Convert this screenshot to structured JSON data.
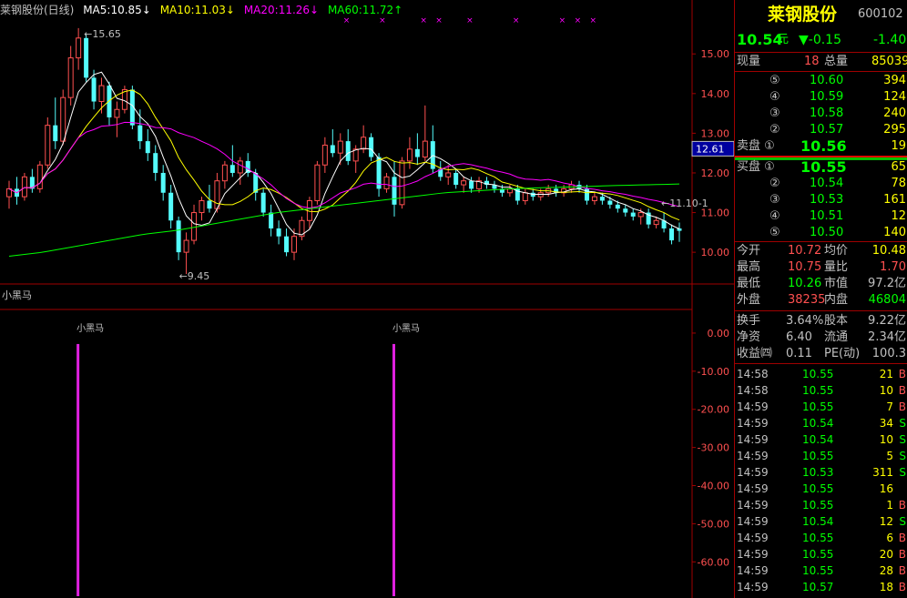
{
  "chart_header": {
    "stock_period": "莱钢股份(日线)",
    "ma5": "MA5:10.85↓",
    "ma10": "MA10:11.03↓",
    "ma20": "MA20:11.26↓",
    "ma60": "MA60:11.72↑",
    "colors": {
      "ma5": "#ffffff",
      "ma10": "#ffff00",
      "ma20": "#ff00ff",
      "ma60": "#00ff00"
    }
  },
  "annotations": {
    "high": "15.65",
    "low": "9.45",
    "last": "11.10-1",
    "price_tag": "12.61"
  },
  "subchart": {
    "title": "小黑马",
    "bar_label": "小黑马"
  },
  "chart_data": [
    {
      "type": "candlestick",
      "title": "莱钢股份(日线)",
      "y_ticks": [
        "15.00",
        "14.00",
        "13.00",
        "12.00",
        "11.00",
        "10.00"
      ],
      "ylim": [
        9.2,
        15.9
      ],
      "ohlc": [
        [
          11.4,
          11.8,
          11.1,
          11.6
        ],
        [
          11.6,
          11.9,
          11.2,
          11.4
        ],
        [
          11.4,
          12.0,
          11.3,
          11.9
        ],
        [
          11.9,
          12.1,
          11.5,
          11.6
        ],
        [
          11.6,
          12.3,
          11.5,
          12.2
        ],
        [
          12.2,
          13.4,
          12.1,
          13.2
        ],
        [
          13.2,
          13.9,
          12.6,
          12.8
        ],
        [
          12.8,
          14.1,
          12.7,
          13.9
        ],
        [
          13.9,
          15.2,
          13.7,
          14.9
        ],
        [
          14.9,
          15.65,
          14.6,
          15.4
        ],
        [
          15.4,
          15.5,
          14.3,
          14.4
        ],
        [
          14.4,
          14.6,
          13.6,
          13.8
        ],
        [
          13.8,
          14.4,
          13.5,
          14.2
        ],
        [
          14.2,
          14.3,
          13.2,
          13.4
        ],
        [
          13.4,
          13.8,
          12.9,
          13.6
        ],
        [
          13.6,
          14.2,
          13.5,
          14.1
        ],
        [
          14.1,
          14.2,
          13.1,
          13.2
        ],
        [
          13.2,
          13.6,
          12.6,
          12.8
        ],
        [
          12.8,
          13.1,
          12.3,
          12.5
        ],
        [
          12.5,
          12.7,
          11.8,
          12.0
        ],
        [
          12.0,
          12.2,
          11.3,
          11.5
        ],
        [
          11.5,
          11.7,
          10.6,
          10.8
        ],
        [
          10.8,
          10.9,
          9.8,
          10.0
        ],
        [
          10.0,
          10.5,
          9.45,
          10.3
        ],
        [
          10.3,
          11.2,
          10.2,
          11.0
        ],
        [
          11.0,
          11.4,
          10.8,
          11.3
        ],
        [
          11.3,
          11.7,
          11.0,
          11.1
        ],
        [
          11.1,
          12.0,
          11.0,
          11.8
        ],
        [
          11.8,
          12.3,
          11.6,
          12.2
        ],
        [
          12.2,
          12.7,
          11.9,
          12.0
        ],
        [
          12.0,
          12.4,
          11.7,
          12.3
        ],
        [
          12.3,
          12.5,
          11.9,
          12.0
        ],
        [
          12.0,
          12.1,
          11.3,
          11.5
        ],
        [
          11.5,
          11.6,
          10.9,
          11.0
        ],
        [
          11.0,
          11.2,
          10.4,
          10.6
        ],
        [
          10.6,
          10.8,
          10.2,
          10.4
        ],
        [
          10.4,
          10.6,
          9.9,
          10.0
        ],
        [
          10.0,
          10.6,
          9.8,
          10.4
        ],
        [
          10.4,
          10.9,
          10.3,
          10.8
        ],
        [
          10.8,
          11.4,
          10.6,
          11.3
        ],
        [
          11.3,
          12.3,
          11.2,
          12.2
        ],
        [
          12.2,
          12.9,
          12.0,
          12.7
        ],
        [
          12.7,
          13.1,
          12.4,
          12.5
        ],
        [
          12.5,
          13.0,
          12.2,
          12.8
        ],
        [
          12.8,
          13.1,
          12.2,
          12.3
        ],
        [
          12.3,
          12.7,
          12.0,
          12.6
        ],
        [
          12.6,
          13.2,
          12.5,
          12.9
        ],
        [
          12.9,
          13.0,
          12.3,
          12.4
        ],
        [
          12.4,
          12.5,
          11.4,
          11.6
        ],
        [
          11.6,
          12.0,
          11.5,
          11.9
        ],
        [
          11.9,
          12.3,
          10.9,
          11.2
        ],
        [
          11.2,
          12.4,
          11.1,
          12.3
        ],
        [
          12.3,
          12.9,
          12.1,
          12.6
        ],
        [
          12.6,
          13.0,
          12.2,
          12.4
        ],
        [
          12.4,
          13.7,
          12.3,
          12.8
        ],
        [
          12.8,
          13.2,
          12.0,
          12.1
        ],
        [
          12.1,
          12.3,
          11.8,
          11.9
        ],
        [
          11.9,
          12.2,
          11.7,
          12.0
        ],
        [
          12.0,
          12.1,
          11.6,
          11.7
        ],
        [
          11.7,
          11.9,
          11.5,
          11.8
        ],
        [
          11.8,
          11.9,
          11.5,
          11.6
        ],
        [
          11.6,
          11.9,
          11.5,
          11.8
        ],
        [
          11.8,
          11.9,
          11.6,
          11.7
        ],
        [
          11.7,
          11.8,
          11.5,
          11.6
        ],
        [
          11.6,
          11.7,
          11.4,
          11.5
        ],
        [
          11.5,
          11.7,
          11.4,
          11.6
        ],
        [
          11.6,
          11.7,
          11.2,
          11.3
        ],
        [
          11.3,
          11.6,
          11.2,
          11.5
        ],
        [
          11.5,
          11.6,
          11.3,
          11.4
        ],
        [
          11.4,
          11.6,
          11.3,
          11.5
        ],
        [
          11.5,
          11.7,
          11.4,
          11.6
        ],
        [
          11.6,
          11.7,
          11.4,
          11.5
        ],
        [
          11.5,
          11.7,
          11.4,
          11.6
        ],
        [
          11.6,
          11.8,
          11.5,
          11.7
        ],
        [
          11.7,
          11.8,
          11.5,
          11.6
        ],
        [
          11.6,
          11.7,
          11.2,
          11.3
        ],
        [
          11.3,
          11.5,
          11.2,
          11.4
        ],
        [
          11.4,
          11.5,
          11.2,
          11.3
        ],
        [
          11.3,
          11.4,
          11.1,
          11.2
        ],
        [
          11.2,
          11.3,
          11.0,
          11.1
        ],
        [
          11.1,
          11.2,
          10.9,
          11.0
        ],
        [
          11.0,
          11.1,
          10.8,
          10.9
        ],
        [
          10.9,
          11.1,
          10.7,
          11.0
        ],
        [
          11.0,
          11.1,
          10.6,
          10.7
        ],
        [
          10.7,
          10.9,
          10.6,
          10.8
        ],
        [
          10.8,
          11.0,
          10.5,
          10.6
        ],
        [
          10.6,
          10.7,
          10.2,
          10.3
        ],
        [
          10.6,
          10.75,
          10.26,
          10.54
        ]
      ]
    },
    {
      "type": "bar",
      "title": "小黑马",
      "y_ticks": [
        "0.00",
        "-10.00",
        "-20.00",
        "-30.00",
        "-40.00",
        "-50.00",
        "-60.00"
      ],
      "ylim": [
        -69,
        5
      ],
      "bars": [
        {
          "index": 9,
          "value": -69
        },
        {
          "index": 50,
          "value": -69
        }
      ]
    }
  ],
  "panel": {
    "name": "莱钢股份",
    "code": "600102",
    "price": "10.54",
    "yuan": "元",
    "change": "▼-0.15",
    "change_pct": "-1.40",
    "xianliang_label": "现量",
    "xianliang": "18",
    "zongliang_label": "总量",
    "zongliang": "85039",
    "sell_levels": [
      {
        "label": "⑤",
        "price": "10.60",
        "vol": "394"
      },
      {
        "label": "④",
        "price": "10.59",
        "vol": "124"
      },
      {
        "label": "③",
        "price": "10.58",
        "vol": "240"
      },
      {
        "label": "②",
        "price": "10.57",
        "vol": "295"
      },
      {
        "label": "卖盘 ①",
        "price": "10.56",
        "vol": "19"
      }
    ],
    "buy_levels": [
      {
        "label": "买盘 ①",
        "price": "10.55",
        "vol": "65"
      },
      {
        "label": "②",
        "price": "10.54",
        "vol": "78"
      },
      {
        "label": "③",
        "price": "10.53",
        "vol": "161"
      },
      {
        "label": "④",
        "price": "10.51",
        "vol": "12"
      },
      {
        "label": "⑤",
        "price": "10.50",
        "vol": "140"
      }
    ],
    "stats": [
      {
        "l1": "今开",
        "v1": "10.72",
        "l2": "均价",
        "v2": "10.48"
      },
      {
        "l1": "最高",
        "v1": "10.75",
        "l2": "量比",
        "v2": "1.70"
      },
      {
        "l1": "最低",
        "v1": "10.26",
        "l2": "市值",
        "v2": "97.2亿"
      },
      {
        "l1": "外盘",
        "v1": "38235",
        "l2": "内盘",
        "v2": "46804"
      }
    ],
    "fin": [
      {
        "l1": "换手",
        "v1": "3.64%",
        "l2": "股本",
        "v2": "9.22亿"
      },
      {
        "l1": "净资",
        "v1": "6.40",
        "l2": "流通",
        "v2": "2.34亿"
      },
      {
        "l1": "收益㈣",
        "v1": "0.11",
        "l2": "PE(动)",
        "v2": "100.3"
      }
    ],
    "trades": [
      {
        "t": "14:58",
        "p": "10.55",
        "v": "21",
        "d": "B"
      },
      {
        "t": "14:58",
        "p": "10.55",
        "v": "10",
        "d": "B"
      },
      {
        "t": "14:59",
        "p": "10.55",
        "v": "7",
        "d": "B"
      },
      {
        "t": "14:59",
        "p": "10.54",
        "v": "34",
        "d": "S"
      },
      {
        "t": "14:59",
        "p": "10.54",
        "v": "10",
        "d": "S"
      },
      {
        "t": "14:59",
        "p": "10.55",
        "v": "5",
        "d": "S"
      },
      {
        "t": "14:59",
        "p": "10.53",
        "v": "311",
        "d": "S"
      },
      {
        "t": "14:59",
        "p": "10.55",
        "v": "16",
        "d": ""
      },
      {
        "t": "14:59",
        "p": "10.55",
        "v": "1",
        "d": "B"
      },
      {
        "t": "14:59",
        "p": "10.54",
        "v": "12",
        "d": "S"
      },
      {
        "t": "14:59",
        "p": "10.55",
        "v": "6",
        "d": "B"
      },
      {
        "t": "14:59",
        "p": "10.55",
        "v": "20",
        "d": "B"
      },
      {
        "t": "14:59",
        "p": "10.55",
        "v": "28",
        "d": "B"
      },
      {
        "t": "14:59",
        "p": "10.57",
        "v": "18",
        "d": "B"
      }
    ]
  }
}
